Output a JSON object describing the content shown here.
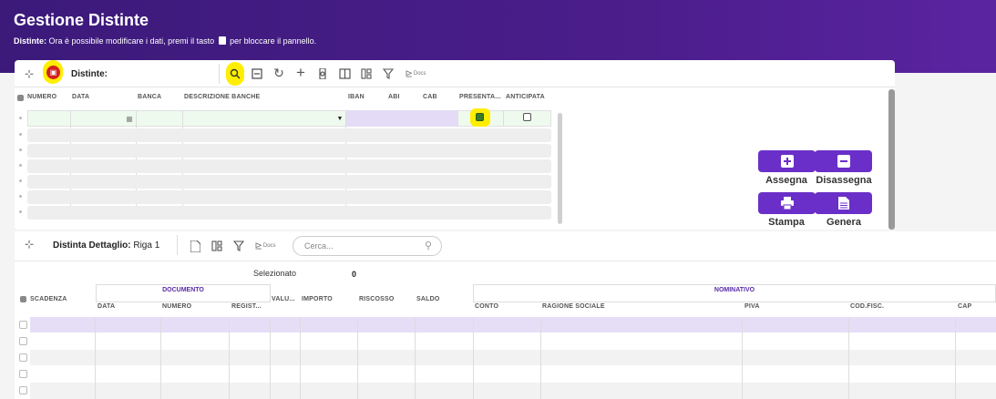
{
  "header": {
    "title": "Gestione Distinte",
    "subtitle_label": "Distinte:",
    "subtitle_text_before": "Ora è possibile modificare i dati, premi il tasto",
    "subtitle_text_after": "per bloccare il pannello."
  },
  "toolbar1": {
    "label": "Distinte:",
    "docs_label": "Docs"
  },
  "grid1": {
    "columns": [
      "NUMERO",
      "DATA",
      "BANCA",
      "DESCRIZIONE BANCHE",
      "IBAN",
      "ABI",
      "CAB",
      "PRESENTA...",
      "ANTICIPATA"
    ]
  },
  "actions": {
    "assegna": "Assegna",
    "disassegna": "Disassegna",
    "stampa": "Stampa",
    "genera": "Genera"
  },
  "toolbar2": {
    "label": "Distinta Dettaglio:",
    "row_label": "Riga 1",
    "docs_label": "Docs",
    "search_placeholder": "Cerca..."
  },
  "summary": {
    "selected_label": "Selezionato",
    "selected_value": "0"
  },
  "grid2": {
    "group_documento": "DOCUMENTO",
    "group_nominativo": "NOMINATIVO",
    "col_scadenza": "SCADENZA",
    "col_data": "DATA",
    "col_numero": "NUMERO",
    "col_regist": "REGIST...",
    "col_valu": "VALU...",
    "col_importo": "IMPORTO",
    "col_riscosso": "RISCOSSO",
    "col_saldo": "SALDO",
    "col_conto": "CONTO",
    "col_ragione": "RAGIONE SOCIALE",
    "col_piva": "PIVA",
    "col_codfisc": "COD.FISC.",
    "col_cap": "CAP"
  },
  "colors": {
    "accent": "#6a2fc8",
    "header_bg": "#4a1d8a",
    "highlight": "#ffee00"
  }
}
